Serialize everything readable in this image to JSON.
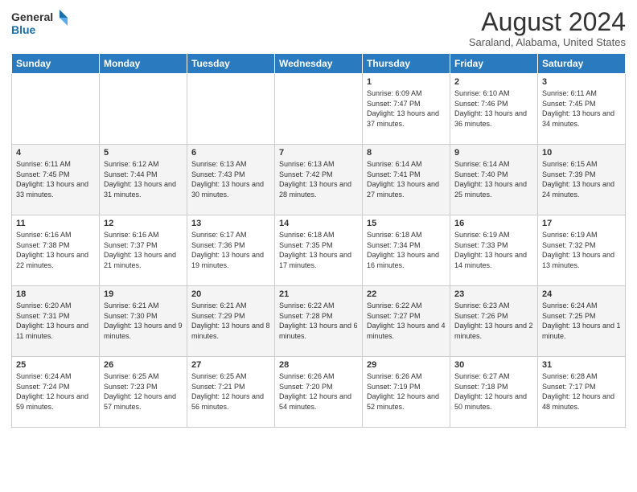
{
  "logo": {
    "line1": "General",
    "line2": "Blue"
  },
  "title": "August 2024",
  "subtitle": "Saraland, Alabama, United States",
  "columns": [
    "Sunday",
    "Monday",
    "Tuesday",
    "Wednesday",
    "Thursday",
    "Friday",
    "Saturday"
  ],
  "rows": [
    [
      {
        "day": "",
        "info": ""
      },
      {
        "day": "",
        "info": ""
      },
      {
        "day": "",
        "info": ""
      },
      {
        "day": "",
        "info": ""
      },
      {
        "day": "1",
        "info": "Sunrise: 6:09 AM\nSunset: 7:47 PM\nDaylight: 13 hours and 37 minutes."
      },
      {
        "day": "2",
        "info": "Sunrise: 6:10 AM\nSunset: 7:46 PM\nDaylight: 13 hours and 36 minutes."
      },
      {
        "day": "3",
        "info": "Sunrise: 6:11 AM\nSunset: 7:45 PM\nDaylight: 13 hours and 34 minutes."
      }
    ],
    [
      {
        "day": "4",
        "info": "Sunrise: 6:11 AM\nSunset: 7:45 PM\nDaylight: 13 hours and 33 minutes."
      },
      {
        "day": "5",
        "info": "Sunrise: 6:12 AM\nSunset: 7:44 PM\nDaylight: 13 hours and 31 minutes."
      },
      {
        "day": "6",
        "info": "Sunrise: 6:13 AM\nSunset: 7:43 PM\nDaylight: 13 hours and 30 minutes."
      },
      {
        "day": "7",
        "info": "Sunrise: 6:13 AM\nSunset: 7:42 PM\nDaylight: 13 hours and 28 minutes."
      },
      {
        "day": "8",
        "info": "Sunrise: 6:14 AM\nSunset: 7:41 PM\nDaylight: 13 hours and 27 minutes."
      },
      {
        "day": "9",
        "info": "Sunrise: 6:14 AM\nSunset: 7:40 PM\nDaylight: 13 hours and 25 minutes."
      },
      {
        "day": "10",
        "info": "Sunrise: 6:15 AM\nSunset: 7:39 PM\nDaylight: 13 hours and 24 minutes."
      }
    ],
    [
      {
        "day": "11",
        "info": "Sunrise: 6:16 AM\nSunset: 7:38 PM\nDaylight: 13 hours and 22 minutes."
      },
      {
        "day": "12",
        "info": "Sunrise: 6:16 AM\nSunset: 7:37 PM\nDaylight: 13 hours and 21 minutes."
      },
      {
        "day": "13",
        "info": "Sunrise: 6:17 AM\nSunset: 7:36 PM\nDaylight: 13 hours and 19 minutes."
      },
      {
        "day": "14",
        "info": "Sunrise: 6:18 AM\nSunset: 7:35 PM\nDaylight: 13 hours and 17 minutes."
      },
      {
        "day": "15",
        "info": "Sunrise: 6:18 AM\nSunset: 7:34 PM\nDaylight: 13 hours and 16 minutes."
      },
      {
        "day": "16",
        "info": "Sunrise: 6:19 AM\nSunset: 7:33 PM\nDaylight: 13 hours and 14 minutes."
      },
      {
        "day": "17",
        "info": "Sunrise: 6:19 AM\nSunset: 7:32 PM\nDaylight: 13 hours and 13 minutes."
      }
    ],
    [
      {
        "day": "18",
        "info": "Sunrise: 6:20 AM\nSunset: 7:31 PM\nDaylight: 13 hours and 11 minutes."
      },
      {
        "day": "19",
        "info": "Sunrise: 6:21 AM\nSunset: 7:30 PM\nDaylight: 13 hours and 9 minutes."
      },
      {
        "day": "20",
        "info": "Sunrise: 6:21 AM\nSunset: 7:29 PM\nDaylight: 13 hours and 8 minutes."
      },
      {
        "day": "21",
        "info": "Sunrise: 6:22 AM\nSunset: 7:28 PM\nDaylight: 13 hours and 6 minutes."
      },
      {
        "day": "22",
        "info": "Sunrise: 6:22 AM\nSunset: 7:27 PM\nDaylight: 13 hours and 4 minutes."
      },
      {
        "day": "23",
        "info": "Sunrise: 6:23 AM\nSunset: 7:26 PM\nDaylight: 13 hours and 2 minutes."
      },
      {
        "day": "24",
        "info": "Sunrise: 6:24 AM\nSunset: 7:25 PM\nDaylight: 13 hours and 1 minute."
      }
    ],
    [
      {
        "day": "25",
        "info": "Sunrise: 6:24 AM\nSunset: 7:24 PM\nDaylight: 12 hours and 59 minutes."
      },
      {
        "day": "26",
        "info": "Sunrise: 6:25 AM\nSunset: 7:23 PM\nDaylight: 12 hours and 57 minutes."
      },
      {
        "day": "27",
        "info": "Sunrise: 6:25 AM\nSunset: 7:21 PM\nDaylight: 12 hours and 56 minutes."
      },
      {
        "day": "28",
        "info": "Sunrise: 6:26 AM\nSunset: 7:20 PM\nDaylight: 12 hours and 54 minutes."
      },
      {
        "day": "29",
        "info": "Sunrise: 6:26 AM\nSunset: 7:19 PM\nDaylight: 12 hours and 52 minutes."
      },
      {
        "day": "30",
        "info": "Sunrise: 6:27 AM\nSunset: 7:18 PM\nDaylight: 12 hours and 50 minutes."
      },
      {
        "day": "31",
        "info": "Sunrise: 6:28 AM\nSunset: 7:17 PM\nDaylight: 12 hours and 48 minutes."
      }
    ]
  ]
}
